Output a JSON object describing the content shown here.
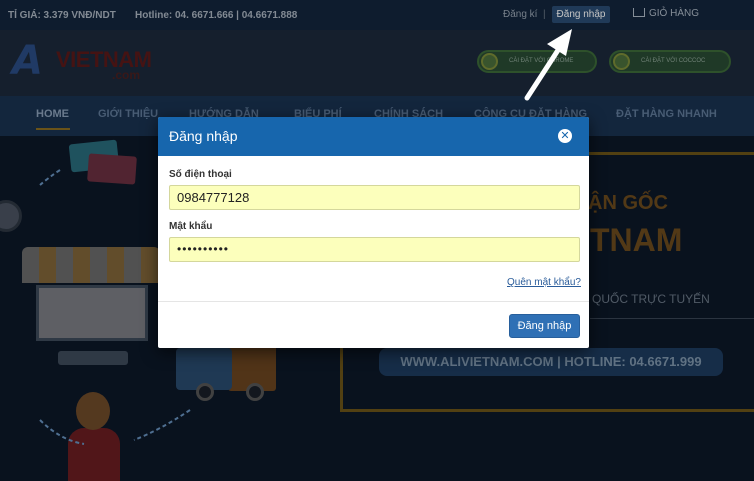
{
  "topbar": {
    "exchange_rate": "TỈ GIÁ: 3.379 VNĐ/NDT",
    "hotline": "Hotline: 04. 6671.666 | 04.6671.888",
    "signup": "Đăng kí",
    "separator": "|",
    "login": "Đăng nhập",
    "cart": "GIỎ HÀNG"
  },
  "header": {
    "logo_mark": "A",
    "logo_name": "VIETNAM",
    "logo_suffix": ".com",
    "extension_button_1": "CÀI ĐẶT VỚI CHROME",
    "extension_button_2": "CÀI ĐẶT VỚI COCCOC"
  },
  "nav": {
    "items": [
      "HOME",
      "GIỚI THIỆU",
      "HƯỚNG DẪN",
      "BIỂU PHÍ",
      "CHÍNH SÁCH",
      "CÔNG CỤ ĐẶT HÀNG",
      "ĐẶT HÀNG NHANH"
    ]
  },
  "banner": {
    "line1": "ẬN GỐC",
    "line2": "TNAM",
    "line3": "QUỐC TRỰC TUYẾN",
    "contact": "WWW.ALIVIETNAM.COM | HOTLINE: 04.6671.999"
  },
  "modal": {
    "title": "Đăng nhập",
    "close_glyph": "✕",
    "phone_label": "Số điện thoại",
    "phone_value": "0984777128",
    "password_label": "Mật khẩu",
    "password_value": "••••••••••",
    "forgot_link": "Quên mật khẩu?",
    "submit_label": "Đăng nhập"
  },
  "colors": {
    "modal_header": "#1766ad",
    "input_fill": "#fcffbc",
    "primary_button": "#2f70b5"
  },
  "icons": [
    "cart-icon",
    "close-icon",
    "arrow-annotation-icon"
  ]
}
